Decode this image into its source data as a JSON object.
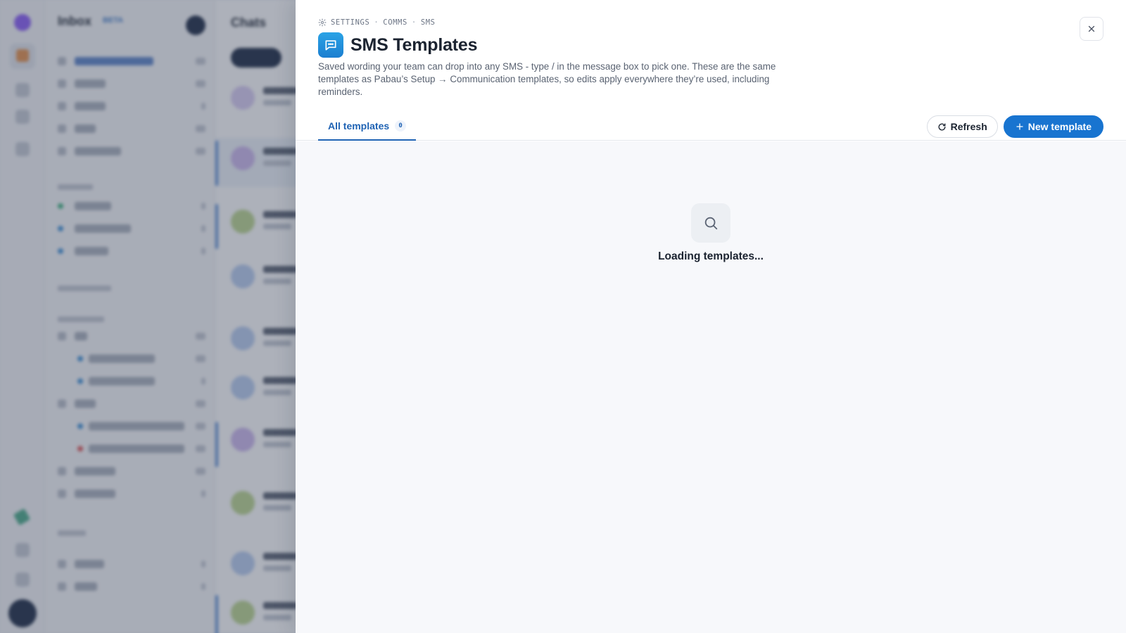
{
  "background": {
    "inbox_title": "Inbox",
    "inbox_badge": "BETA",
    "chats_title": "Chats"
  },
  "header": {
    "breadcrumb": [
      "SETTINGS",
      "COMMS",
      "SMS"
    ],
    "breadcrumb_separator": "·",
    "title": "SMS Templates",
    "description": "Saved wording your team can drop into any SMS - type / in the message box to pick one. These are the same templates as Pabau’s Setup → Communication templates, so edits apply everywhere they’re used, including reminders.",
    "close_label": "×"
  },
  "tabs": [
    {
      "label": "All templates",
      "count": "0",
      "active": true
    }
  ],
  "actions": {
    "refresh_label": "Refresh",
    "new_template_label": "New template"
  },
  "body": {
    "loading_text": "Loading templates..."
  },
  "colors": {
    "primary": "#1874d0",
    "accent_tab": "#1f63b4",
    "app_icon": "#1b8fdc"
  },
  "icons": {
    "breadcrumb": "gear-icon",
    "app": "chat-bubble-icon",
    "close": "close-icon",
    "refresh": "refresh-icon",
    "new": "plus-icon",
    "empty": "search-icon"
  }
}
